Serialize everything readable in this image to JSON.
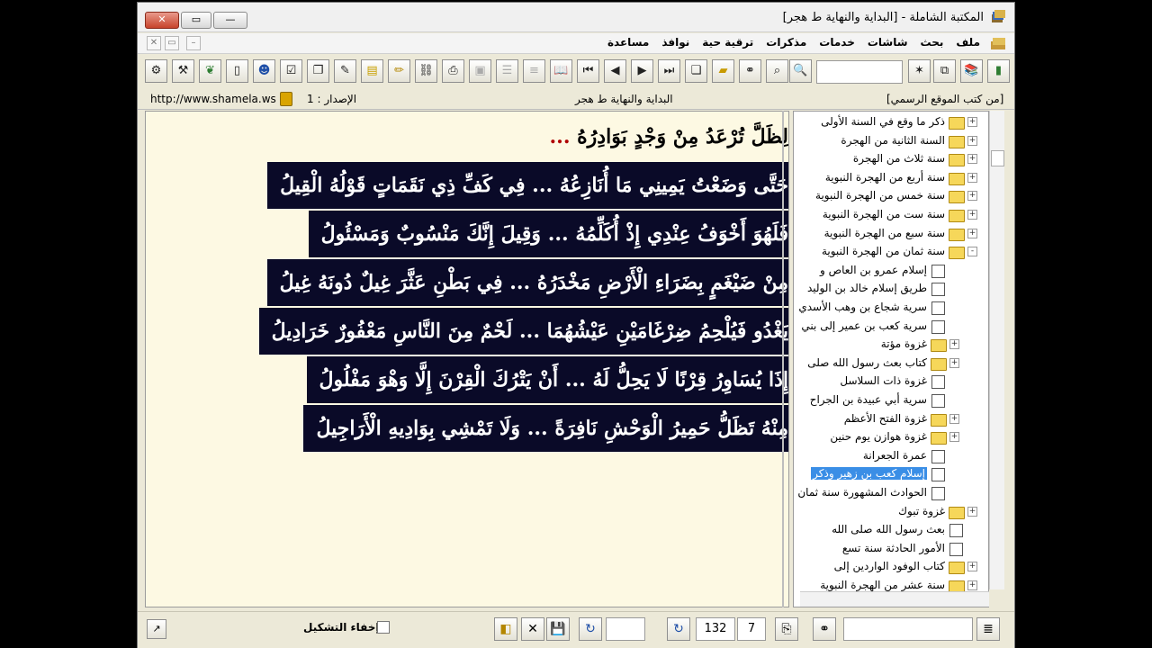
{
  "window": {
    "title": "المكتبة الشاملة - [البداية والنهاية ط هجر]",
    "close_label": "✕",
    "max_label": "▭",
    "min_label": "—"
  },
  "menu": {
    "items": [
      "ملف",
      "بحث",
      "شاشات",
      "خدمات",
      "مذكرات",
      "ترقية حية",
      "نوافذ",
      "مساعدة"
    ]
  },
  "toolbar": {
    "icons": [
      "settings-icon",
      "tools-icon",
      "leaf-icon",
      "new-page-icon",
      "people-icon",
      "checklist-icon",
      "copy-icon",
      "notes-icon",
      "chart-icon",
      "pen-icon",
      "binding-icon",
      "print-icon",
      "disabled-icon",
      "list-icon",
      "text-lines-icon",
      "open-book-icon",
      "first-icon",
      "previous-icon",
      "next-icon",
      "last-icon",
      "windows-icon",
      "folder-open-icon",
      "binoculars-icon",
      "save-search-icon",
      "search-result-icon"
    ],
    "right_icons": [
      "new-star-icon",
      "layout-icon",
      "books-icon",
      "book-icon"
    ]
  },
  "address": {
    "url": "http://www.shamela.ws",
    "version": "الإصدار : 1",
    "book_title": "البداية والنهاية ط هجر",
    "site": "[من كتب الموقع الرسمي]"
  },
  "reader": {
    "lines": [
      {
        "first": "لِظَلَّ تُرْعَدُ مِنْ وَجْدٍ بَوَادِرُهُ",
        "second": "",
        "selected": false
      },
      {
        "first": "حَتَّى وَضَعْتُ يَمِينِي مَا أُنَازِعُهُ",
        "second": "فِي كَفِّ ذِي نَقَمَاتٍ قَوْلُهُ الْقِيلُ",
        "selected": true
      },
      {
        "first": "فَلَهُوَ أَخْوَفُ عِنْدِي إِذْ أُكَلِّمُهُ",
        "second": "وَقِيلَ إِنَّكَ مَنْسُوبٌ وَمَسْئُولُ",
        "selected": true
      },
      {
        "first": "مِنْ ضَيْغَمٍ بِضَرَاءِ الْأَرْضِ مَخْدَرُهُ",
        "second": "فِي بَطْنِ عَثَّرَ غِيلٌ دُونَهُ غِيلُ",
        "selected": true
      },
      {
        "first": "يَغْدُو فَيُلْحِمُ ضِرْغَامَيْنِ عَيْشُهُمَا",
        "second": "لَحْمٌ مِنَ النَّاسِ مَعْفُورٌ خَرَادِيلُ",
        "selected": true
      },
      {
        "first": "إِذَا يُسَاوِرُ قِرْنًا لَا يَحِلُّ لَهُ",
        "second": "أَنْ يَتْرُكَ الْقِرْنَ إِلَّا وَهْوَ مَفْلُولُ",
        "selected": true
      },
      {
        "first": "مِنْهُ تَظَلُّ حَمِيرُ الْوَحْشِ نَافِرَةً",
        "second": "وَلَا تَمْشِي بِوَادِيهِ الْأَرَاجِيلُ",
        "selected": true
      }
    ],
    "separator": "..."
  },
  "tree": {
    "items": [
      {
        "label": "ذكر ما وقع في السنة الأولى",
        "type": "folder",
        "expand": "+",
        "level": 0
      },
      {
        "label": "السنة الثانية من الهجرة",
        "type": "folder",
        "expand": "+",
        "level": 0
      },
      {
        "label": "سنة ثلاث من الهجرة",
        "type": "folder",
        "expand": "+",
        "level": 0
      },
      {
        "label": "سنة أربع من الهجرة النبوية",
        "type": "folder",
        "expand": "+",
        "level": 0
      },
      {
        "label": "سنة خمس من الهجرة النبوية",
        "type": "folder",
        "expand": "+",
        "level": 0
      },
      {
        "label": "سنة ست من الهجرة النبوية",
        "type": "folder",
        "expand": "+",
        "level": 0
      },
      {
        "label": "سنة سبع من الهجرة النبوية",
        "type": "folder",
        "expand": "+",
        "level": 0
      },
      {
        "label": "سنة ثمان من الهجرة النبوية",
        "type": "folder-open",
        "expand": "-",
        "level": 0
      },
      {
        "label": "إسلام عمرو بن العاص و",
        "type": "page",
        "expand": "",
        "level": 1
      },
      {
        "label": "طريق إسلام خالد بن الوليد",
        "type": "page",
        "expand": "",
        "level": 1
      },
      {
        "label": "سرية شجاع بن وهب الأسدي",
        "type": "page",
        "expand": "",
        "level": 1
      },
      {
        "label": "سرية كعب بن عمير إلى بني",
        "type": "page",
        "expand": "",
        "level": 1
      },
      {
        "label": "غزوة مؤتة",
        "type": "folder",
        "expand": "+",
        "level": 1
      },
      {
        "label": "كتاب بعث رسول الله صلى",
        "type": "folder",
        "expand": "+",
        "level": 1
      },
      {
        "label": "غزوة ذات السلاسل",
        "type": "page",
        "expand": "",
        "level": 1
      },
      {
        "label": "سرية أبي عبيدة بن الجراح",
        "type": "page",
        "expand": "",
        "level": 1
      },
      {
        "label": "غزوة الفتح الأعظم",
        "type": "folder",
        "expand": "+",
        "level": 1
      },
      {
        "label": "غزوة هوازن يوم حنين",
        "type": "folder",
        "expand": "+",
        "level": 1
      },
      {
        "label": "عمرة الجعرانة",
        "type": "page",
        "expand": "",
        "level": 1
      },
      {
        "label": "إسلام كعب بن زهير وذكر",
        "type": "page",
        "expand": "",
        "level": 1,
        "selected": true
      },
      {
        "label": "الحوادث المشهورة سنة ثمان",
        "type": "page",
        "expand": "",
        "level": 1
      },
      {
        "label": "غزوة تبوك",
        "type": "folder",
        "expand": "+",
        "level": 0
      },
      {
        "label": "بعث رسول الله صلى الله",
        "type": "page",
        "expand": "",
        "level": 0
      },
      {
        "label": "الأمور الحادثة سنة تسع",
        "type": "page",
        "expand": "",
        "level": 0
      },
      {
        "label": "كتاب الوفود الواردين إلى",
        "type": "folder",
        "expand": "+",
        "level": 0
      },
      {
        "label": "سنة عشر من الهجرة النبوية",
        "type": "folder",
        "expand": "+",
        "level": 0
      }
    ]
  },
  "statusbar": {
    "hide_tashkeel_label": "إخفاء التشكيل",
    "page": "132",
    "part": "7"
  },
  "colors": {
    "selection_bg": "#0a0a28",
    "reader_bg": "#fdf9e3",
    "separator": "#b00000",
    "tree_highlight": "#3a8ee6"
  }
}
